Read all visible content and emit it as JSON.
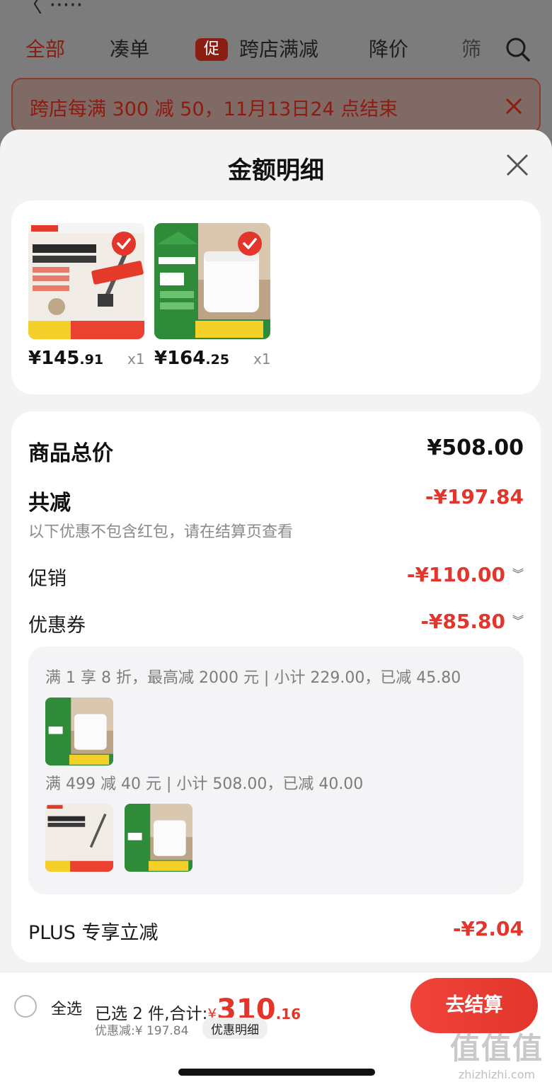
{
  "background": {
    "tabs": [
      {
        "label": "全部",
        "active": true
      },
      {
        "label": "凑单",
        "active": false
      },
      {
        "badge": "促",
        "label": "跨店满减",
        "active": false
      },
      {
        "label": "降价",
        "active": false
      },
      {
        "label": "筛",
        "active": false
      }
    ],
    "notice": "跨店每满 300 减 50，11月13日24 点结束"
  },
  "sheet": {
    "title": "金额明细",
    "products": [
      {
        "price_int": "¥145",
        "price_dec": ".91",
        "qty": "x1",
        "image": "vacuum-product-image"
      },
      {
        "price_int": "¥164",
        "price_dec": ".25",
        "qty": "x1",
        "image": "rice-cooker-product-image"
      }
    ],
    "summary": {
      "total_label": "商品总价",
      "total_value": "¥508.00",
      "reduce_label": "共减",
      "reduce_value": "-¥197.84",
      "reduce_note": "以下优惠不包含红包，请在结算页查看",
      "promo_label": "促销",
      "promo_value": "-¥110.00",
      "coupon_label": "优惠券",
      "coupon_value": "-¥85.80",
      "coupon_details": [
        "满 1 享 8 折，最高减 2000 元 | 小计 229.00，已减 45.80",
        "满 499 减 40 元 | 小计 508.00，已减 40.00"
      ],
      "plus_label": "PLUS 专享立减",
      "plus_value": "-¥2.04"
    }
  },
  "bottom": {
    "select_all": "全选",
    "selected_text": "已选 2 件,合计:",
    "yen": "¥",
    "total_int": "310",
    "total_dec": ".16",
    "discount_note": "优惠减:¥ 197.84",
    "detail_button": "优惠明细",
    "checkout_button": "去结算"
  },
  "watermark": {
    "big": "值值值",
    "small": "zhizhizhi.com"
  },
  "colors": {
    "accent_red": "#e2352b",
    "sheet_bg": "#f3f3f3"
  }
}
